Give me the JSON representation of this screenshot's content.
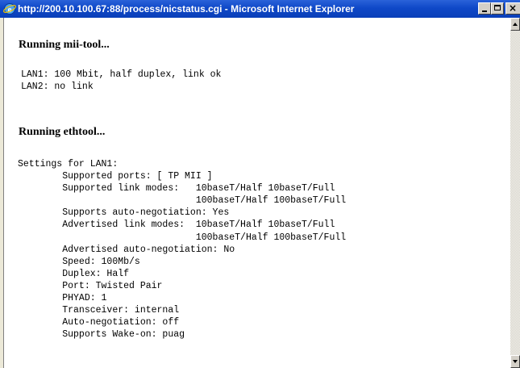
{
  "window": {
    "title": "http://200.10.100.67:88/process/nicstatus.cgi - Microsoft Internet Explorer",
    "close_glyph": "×"
  },
  "colors": {
    "titlebar": "#0f48c8",
    "content_bg": "#ffffff",
    "text": "#000000"
  },
  "sections": [
    {
      "heading": "Running mii-tool...",
      "output": "LAN1: 100 Mbit, half duplex, link ok\nLAN2: no link"
    },
    {
      "heading": "Running ethtool...",
      "output": "Settings for LAN1:\n        Supported ports: [ TP MII ]\n        Supported link modes:   10baseT/Half 10baseT/Full\n                                100baseT/Half 100baseT/Full\n        Supports auto-negotiation: Yes\n        Advertised link modes:  10baseT/Half 10baseT/Full\n                                100baseT/Half 100baseT/Full\n        Advertised auto-negotiation: No\n        Speed: 100Mb/s\n        Duplex: Half\n        Port: Twisted Pair\n        PHYAD: 1\n        Transceiver: internal\n        Auto-negotiation: off\n        Supports Wake-on: puag"
    }
  ]
}
